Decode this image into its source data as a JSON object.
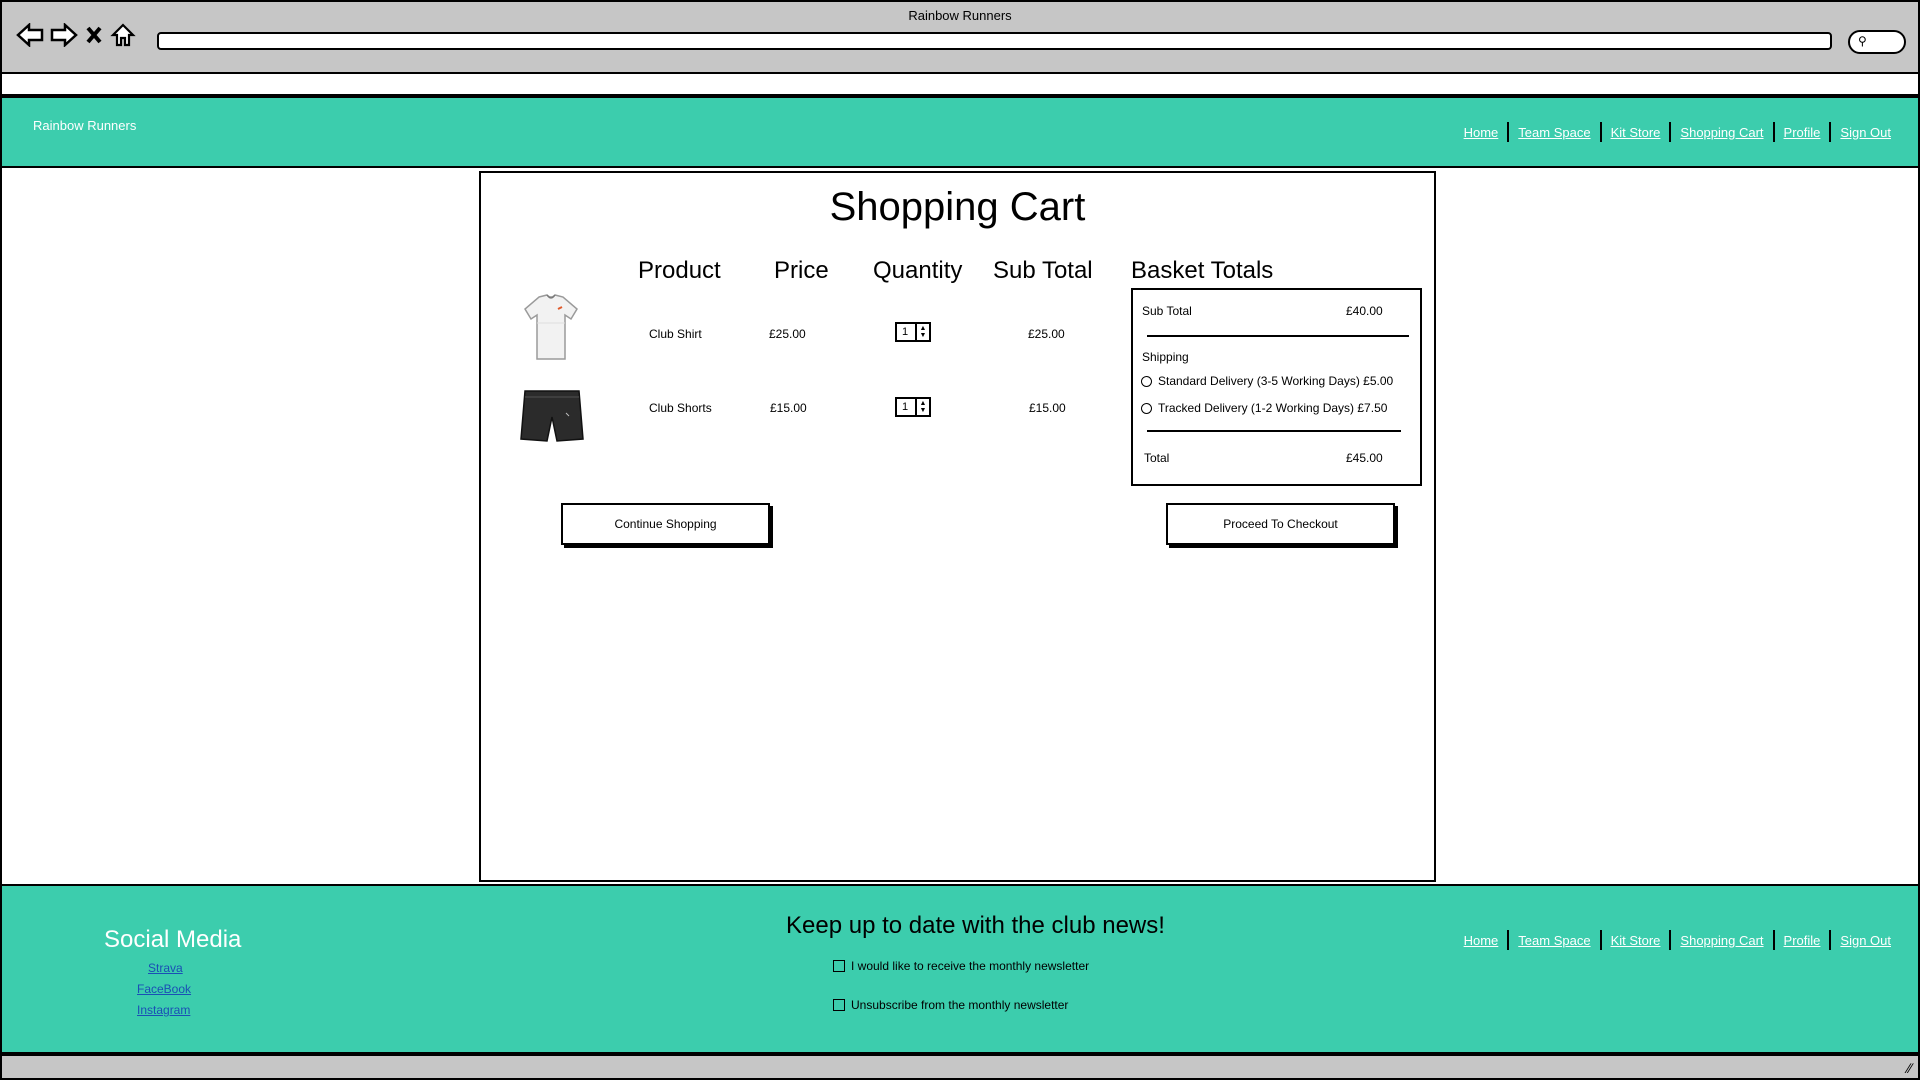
{
  "browser": {
    "window_title": "Rainbow Runners"
  },
  "header": {
    "brand": "Rainbow Runners",
    "nav": [
      "Home",
      "Team Space",
      "Kit Store",
      "Shopping Cart",
      "Profile",
      "Sign Out"
    ]
  },
  "cart": {
    "title": "Shopping Cart",
    "columns": {
      "product": "Product",
      "price": "Price",
      "quantity": "Quantity",
      "subtotal": "Sub Total"
    },
    "items": [
      {
        "name": "Club Shirt",
        "price": "£25.00",
        "quantity": "1",
        "subtotal": "£25.00",
        "image_icon": "shirt-icon"
      },
      {
        "name": "Club Shorts",
        "price": "£15.00",
        "quantity": "1",
        "subtotal": "£15.00",
        "image_icon": "shorts-icon"
      }
    ],
    "continue_label": "Continue Shopping",
    "checkout_label": "Proceed To Checkout"
  },
  "basket": {
    "title": "Basket Totals",
    "subtotal_label": "Sub Total",
    "subtotal_value": "£40.00",
    "shipping_label": "Shipping",
    "options": [
      "Standard Delivery (3-5 Working Days) £5.00",
      "Tracked Delivery (1-2 Working Days) £7.50"
    ],
    "total_label": "Total",
    "total_value": "£45.00"
  },
  "footer": {
    "social_title": "Social Media",
    "social_links": [
      "Strava",
      "FaceBook",
      "Instagram"
    ],
    "news_title": "Keep up to date with the club news!",
    "newsletter_options": [
      "I would like to receive the monthly newsletter",
      "Unsubscribe from the monthly newsletter"
    ],
    "nav": [
      "Home",
      "Team Space",
      "Kit Store",
      "Shopping Cart",
      "Profile",
      "Sign Out"
    ]
  },
  "colors": {
    "brand_green": "#3ccdad",
    "chrome_gray": "#c6c6c6",
    "link_blue": "#1a4fb5"
  }
}
